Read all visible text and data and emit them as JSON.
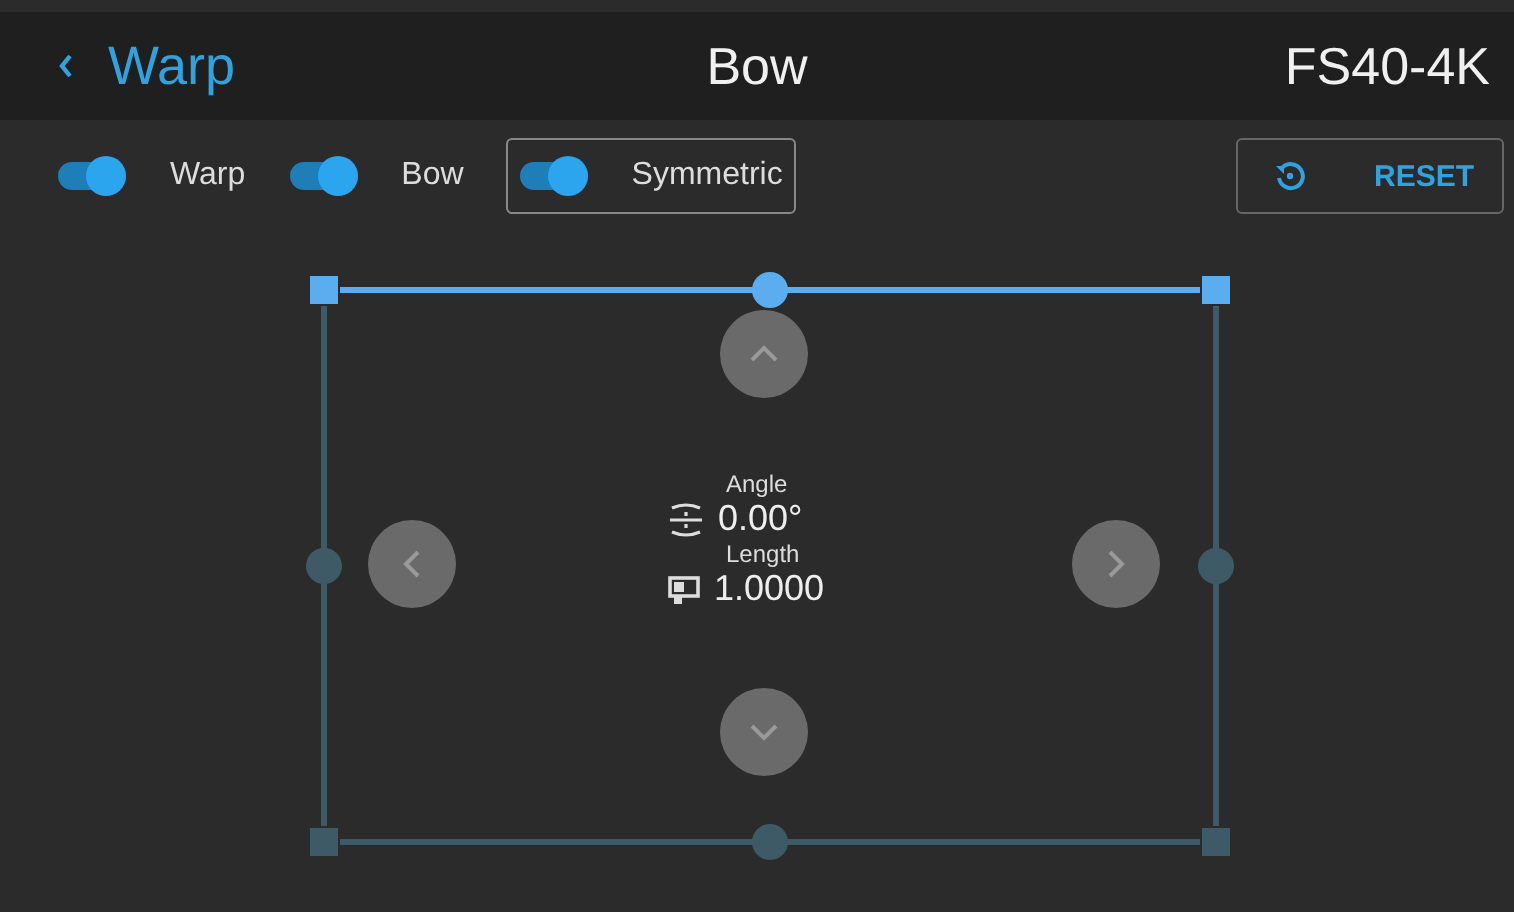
{
  "header": {
    "back_label": "Warp",
    "title": "Bow",
    "model": "FS40-4K"
  },
  "toggles": [
    {
      "label": "Warp",
      "on": true,
      "focused": false
    },
    {
      "label": "Bow",
      "on": true,
      "focused": false
    },
    {
      "label": "Symmetric",
      "on": true,
      "focused": true
    }
  ],
  "reset_button": {
    "label": "RESET"
  },
  "frame": {
    "edges": [
      {
        "selected": true
      },
      {
        "selected": false
      },
      {
        "selected": false
      },
      {
        "selected": false
      }
    ]
  },
  "readout": {
    "angle_label": "Angle",
    "angle_value": "0.00°",
    "length_label": "Length",
    "length_value": "1.0000"
  }
}
